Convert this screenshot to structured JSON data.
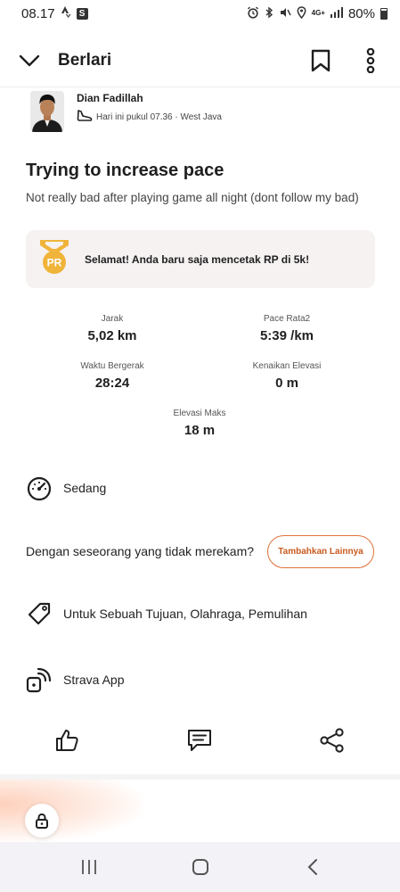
{
  "status_bar": {
    "time": "08.17",
    "network": "4G+",
    "battery": "80%"
  },
  "app_bar": {
    "title": "Berlari"
  },
  "athlete": {
    "name": "Dian Fadillah",
    "meta": "Hari ini pukul 07.36 · West Java"
  },
  "activity": {
    "title": "Trying to increase pace",
    "description": "Not really bad after playing game all night (dont follow my bad)"
  },
  "pr_card": {
    "badge": "PR",
    "message": "Selamat! Anda baru saja mencetak RP di 5k!"
  },
  "stats": {
    "distance": {
      "label": "Jarak",
      "value": "5,02 km"
    },
    "avg_pace": {
      "label": "Pace Rata2",
      "value": "5:39 /km"
    },
    "moving_time": {
      "label": "Waktu Bergerak",
      "value": "28:24"
    },
    "elevation_gain": {
      "label": "Kenaikan Elevasi",
      "value": "0 m"
    },
    "max_elevation": {
      "label": "Elevasi Maks",
      "value": "18 m"
    }
  },
  "effort": {
    "label": "Sedang"
  },
  "with_people": {
    "question": "Dengan seseorang yang tidak merekam?",
    "button": "Tambahkan Lainnya"
  },
  "tags": {
    "label": "Untuk Sebuah Tujuan, Olahraga, Pemulihan"
  },
  "device": {
    "label": "Strava App"
  },
  "icons": {
    "back": "chevron-down-icon",
    "bookmark": "bookmark-icon",
    "more": "more-vertical-icon",
    "shoe": "shoe-icon",
    "effort": "speedometer-icon",
    "tag": "tag-icon",
    "device": "device-signal-icon",
    "like": "thumbs-up-icon",
    "comment": "comment-icon",
    "share": "share-icon",
    "lock": "lock-icon"
  },
  "colors": {
    "accent": "#e0733a",
    "pr_gold": "#f0b43a",
    "card_bg": "#f6f2f2"
  }
}
